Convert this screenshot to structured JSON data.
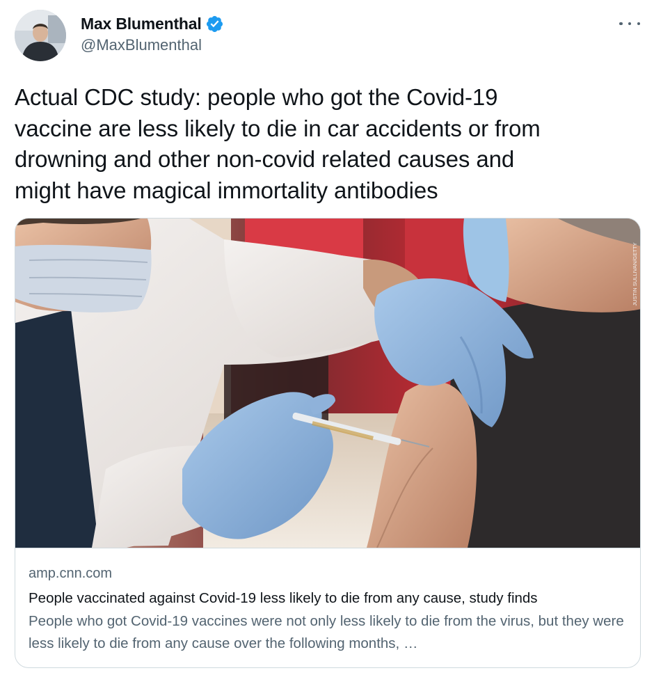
{
  "author": {
    "display_name": "Max Blumenthal",
    "handle": "@MaxBlumenthal",
    "verified_icon": "verified-badge-icon",
    "avatar": "profile-photo"
  },
  "more_icon": "ellipsis-icon",
  "tweet": {
    "text": "Actual CDC study: people who got the Covid-19\nvaccine are less likely to die in car accidents or from\ndrowning and other non-covid related causes and\nmight have magical immortality antibodies"
  },
  "link_card": {
    "image": "photo of health worker in blue gloves vaccinating a patient's arm",
    "photo_credit": "JUSTIN SULLIVAN/GETTY",
    "domain": "amp.cnn.com",
    "title": "People vaccinated against Covid-19 less likely to die from any cause, study finds",
    "description": "People who got Covid-19 vaccines were not only less likely to die from the virus, but they were less likely to die from any cause over the following months, …"
  },
  "colors": {
    "text_primary": "#0f1419",
    "text_secondary": "#536471",
    "verified_blue": "#1d9bf0",
    "card_border": "#cfd9de"
  }
}
